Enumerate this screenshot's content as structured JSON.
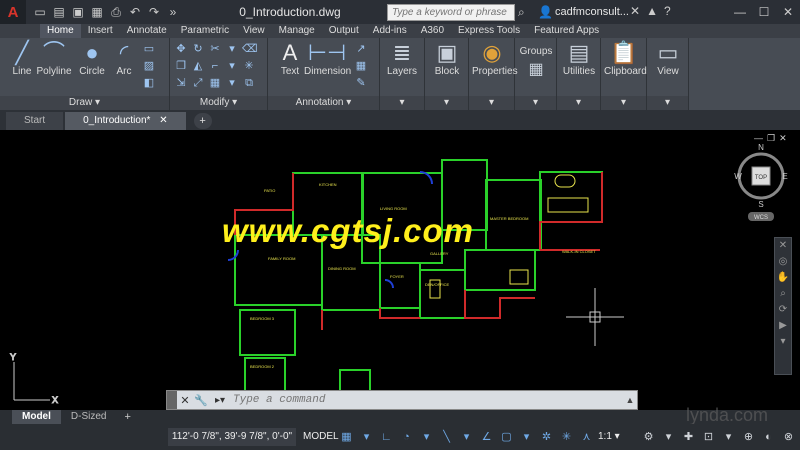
{
  "app": {
    "logo": "A",
    "doc_title": "0_Introduction.dwg",
    "search_placeholder": "Type a keyword or phrase",
    "user": "cadfmconsult..."
  },
  "ribbon_tabs": [
    "Home",
    "Insert",
    "Annotate",
    "Parametric",
    "View",
    "Manage",
    "Output",
    "Add-ins",
    "A360",
    "Express Tools",
    "Featured Apps"
  ],
  "ribbon": {
    "draw": {
      "line": "Line",
      "polyline": "Polyline",
      "circle": "Circle",
      "arc": "Arc",
      "title": "Draw"
    },
    "modify": {
      "title": "Modify"
    },
    "annotation": {
      "text": "Text",
      "dimension": "Dimension",
      "title": "Annotation"
    },
    "layers": "Layers",
    "block": "Block",
    "properties": "Properties",
    "groups": "Groups",
    "utilities": "Utilities",
    "clipboard": "Clipboard",
    "view": "View"
  },
  "doc_tabs": {
    "start": "Start",
    "current": "0_Introduction*"
  },
  "viewcube": {
    "top": "TOP",
    "n": "N",
    "s": "S",
    "e": "E",
    "w": "W",
    "wcs": "WCS"
  },
  "drawing_labels": {
    "patio": "PATIO",
    "kitchen": "KITCHEN",
    "living": "LIVING ROOM",
    "family": "FAMILY ROOM",
    "dining": "DINING ROOM",
    "foyer": "FOYER",
    "gallery": "GALLERY",
    "den": "DEN/OFFICE",
    "bedroom3": "BEDROOM 3",
    "bedroom2": "BEDROOM 2",
    "master": "MASTER BEDROOM",
    "walkin": "WALK-IN CLOSET"
  },
  "watermark": "www.cgtsj.com",
  "command": {
    "placeholder": "Type a command"
  },
  "layout_tabs": {
    "model": "Model",
    "dsized": "D-Sized"
  },
  "lynda": "lynda.com",
  "status": {
    "coords": "112'-0 7/8\", 39'-9 7/8\", 0'-0\"",
    "model": "MODEL",
    "scale": "1:1"
  }
}
